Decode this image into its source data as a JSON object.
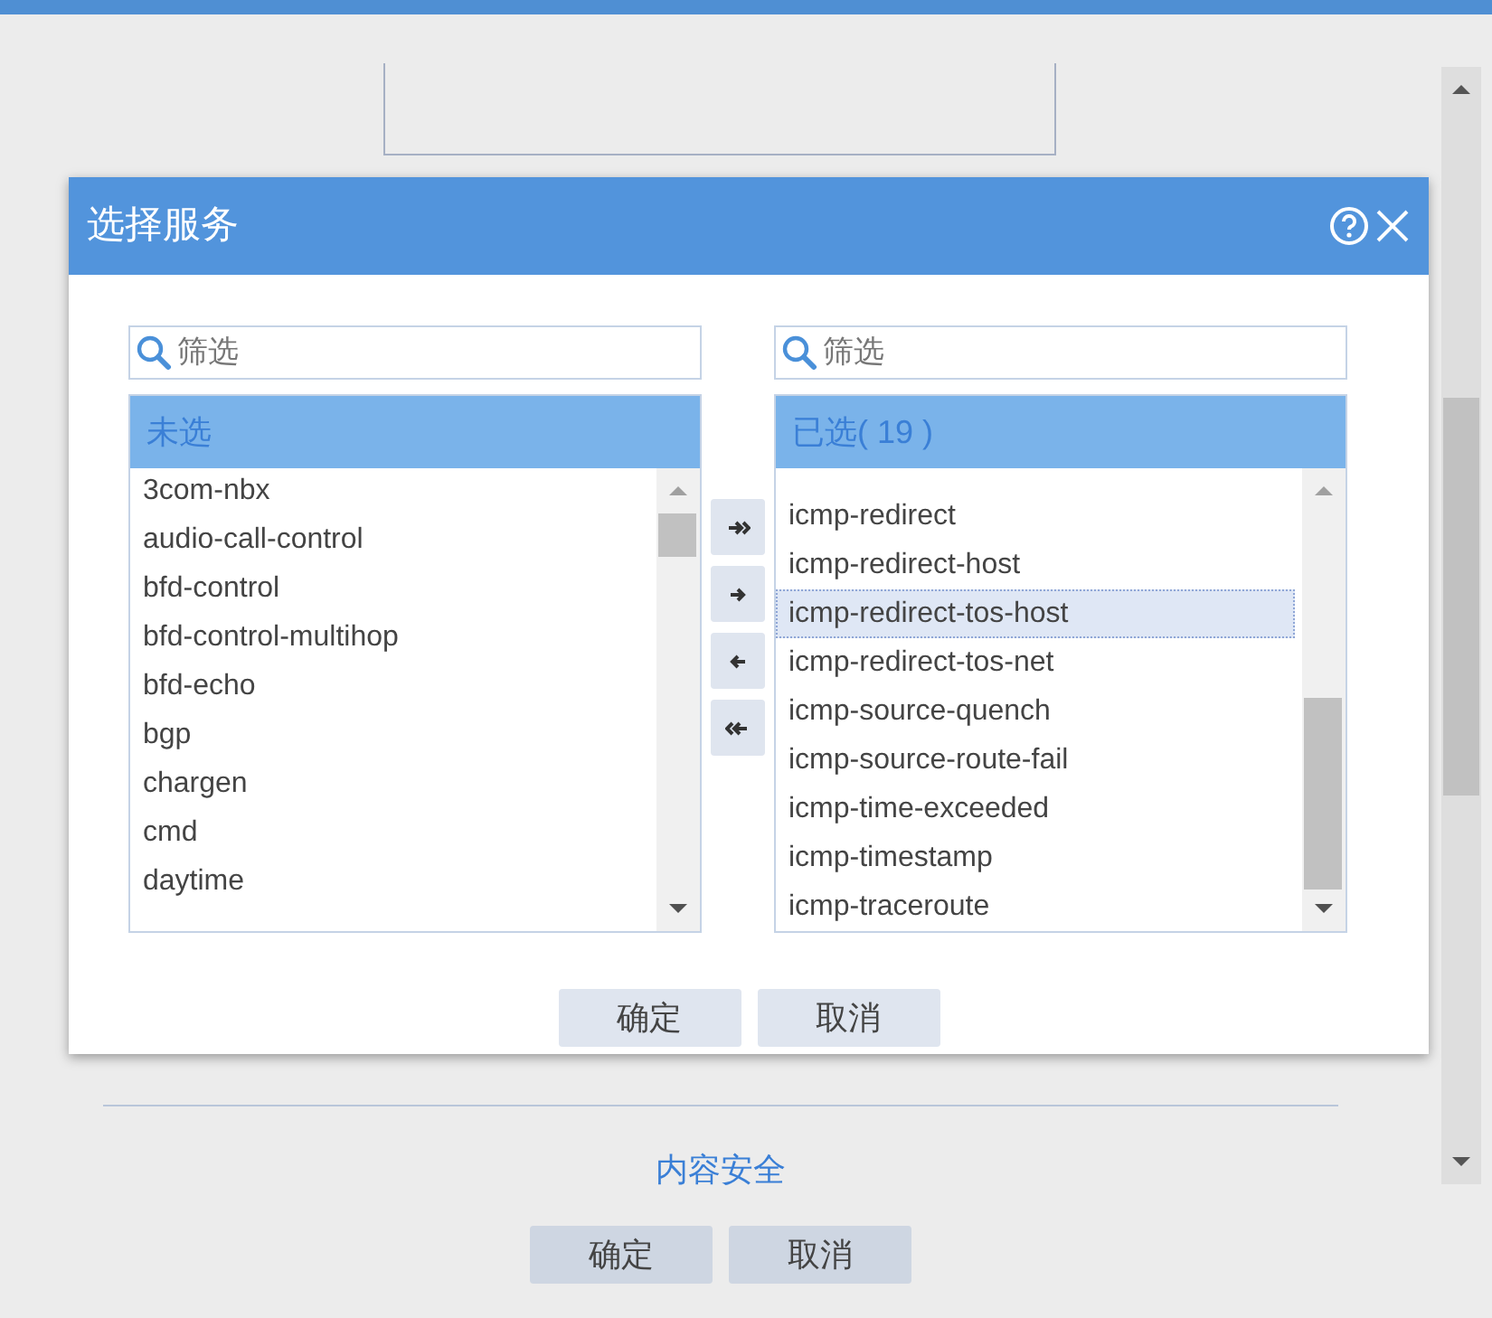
{
  "page": {
    "section_link": "内容安全",
    "buttons": [
      "确定",
      "取消"
    ]
  },
  "dialog": {
    "title": "选择服务",
    "available": {
      "filter_placeholder": "筛选",
      "header": "未选",
      "items": [
        {
          "label": "3com-nbx",
          "selected": false
        },
        {
          "label": "audio-call-control",
          "selected": false
        },
        {
          "label": "bfd-control",
          "selected": false
        },
        {
          "label": "bfd-control-multihop",
          "selected": false
        },
        {
          "label": "bfd-echo",
          "selected": false
        },
        {
          "label": "bgp",
          "selected": false
        },
        {
          "label": "chargen",
          "selected": false
        },
        {
          "label": "cmd",
          "selected": false
        },
        {
          "label": "daytime",
          "selected": false
        }
      ]
    },
    "move_buttons": [
      {
        "kind": "all-right"
      },
      {
        "kind": "right"
      },
      {
        "kind": "left"
      },
      {
        "kind": "all-left"
      }
    ],
    "chosen": {
      "filter_placeholder": "筛选",
      "header": "已选( 19 )",
      "items": [
        {
          "label": "icmp-redirect",
          "selected": false
        },
        {
          "label": "icmp-redirect-host",
          "selected": false
        },
        {
          "label": "icmp-redirect-tos-host",
          "selected": true
        },
        {
          "label": "icmp-redirect-tos-net",
          "selected": false
        },
        {
          "label": "icmp-source-quench",
          "selected": false
        },
        {
          "label": "icmp-source-route-fail",
          "selected": false
        },
        {
          "label": "icmp-time-exceeded",
          "selected": false
        },
        {
          "label": "icmp-timestamp",
          "selected": false
        },
        {
          "label": "icmp-traceroute",
          "selected": false
        }
      ]
    },
    "buttons": [
      "确定",
      "取消"
    ]
  }
}
